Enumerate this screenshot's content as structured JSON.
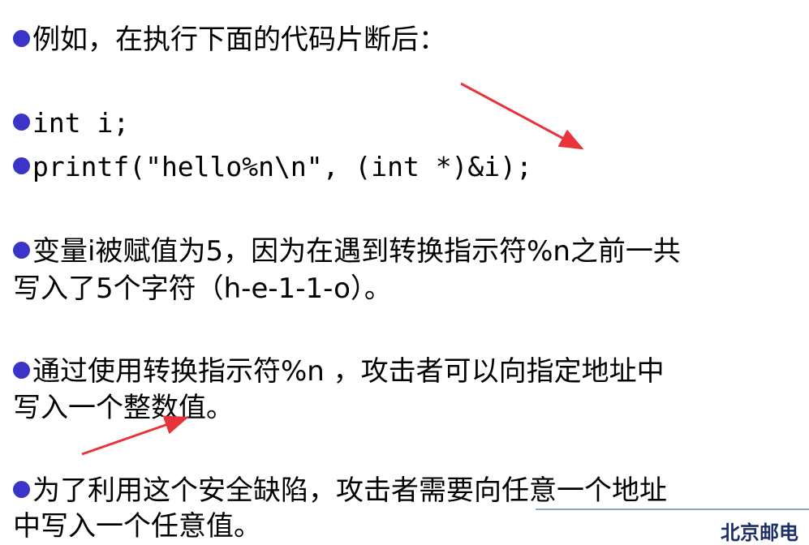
{
  "lines": {
    "l1": "例如，在执行下面的代码片断后：",
    "l2": "int i;",
    "l3": "printf(\"hello%n\\n\", (int *)&i);",
    "l4a": "变量i被赋值为5，因为在遇到转换指示符%n之前一共",
    "l4b": "写入了5个字符（h-e-1-1-o）。",
    "l5a": "通过使用转换指示符%n ，攻击者可以向指定地址中",
    "l5b": "写入一个整数值。",
    "l6a": "为了利用这个安全缺陷，攻击者需要向任意一个地址",
    "l6b": "中写入一个任意值。"
  },
  "footer": {
    "text": "北京邮电"
  },
  "colors": {
    "bullet": "#3a35c8",
    "arrow": "#e8333a",
    "footer_rule": "#8aa9bd"
  }
}
